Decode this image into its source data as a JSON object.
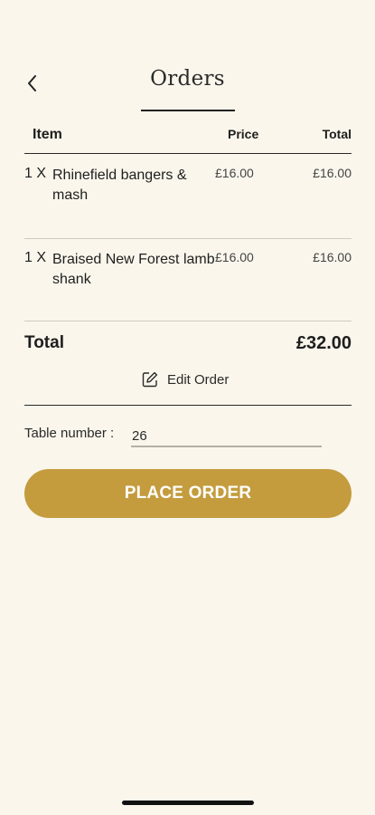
{
  "header": {
    "title": "Orders"
  },
  "table_header": {
    "item": "Item",
    "price": "Price",
    "total": "Total"
  },
  "items": [
    {
      "qty": "1 X",
      "name": "Rhinefield bangers & mash",
      "price": "£16.00",
      "total": "£16.00"
    },
    {
      "qty": "1 X",
      "name": "Braised New Forest lamb shank",
      "price": "£16.00",
      "total": "£16.00"
    }
  ],
  "summary": {
    "total_label": "Total",
    "total_value": "£32.00"
  },
  "edit_order_label": "Edit Order",
  "table_number": {
    "label": "Table number :",
    "value": "26"
  },
  "place_order_label": "PLACE ORDER",
  "colors": {
    "background": "#faf6ec",
    "accent": "#c49c3e"
  },
  "icons": {
    "back": "chevron-left-icon",
    "edit": "edit-icon"
  }
}
